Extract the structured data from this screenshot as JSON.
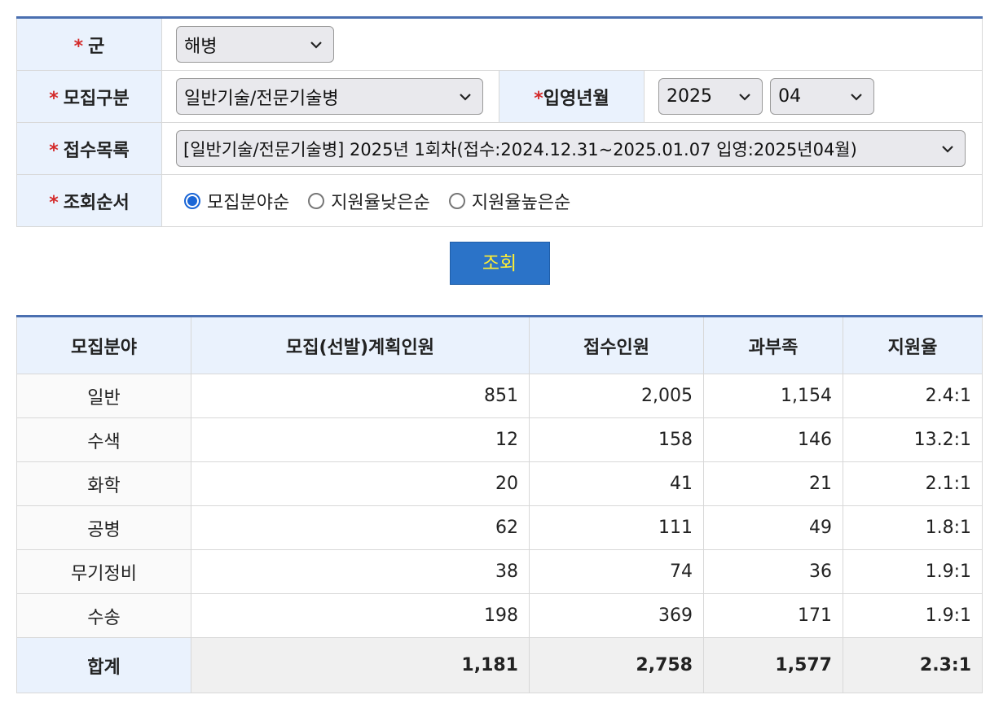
{
  "form": {
    "branch": {
      "label": "군",
      "value": "해병"
    },
    "recruit_type": {
      "label": "모집구분",
      "value": "일반기술/전문기술병"
    },
    "enlist_month": {
      "label": "입영년월",
      "year": "2025",
      "month": "04"
    },
    "application_list": {
      "label": "접수목록",
      "value": "[일반기술/전문기술병] 2025년 1회차(접수:2024.12.31~2025.01.07 입영:2025년04월)"
    },
    "sort_order": {
      "label": "조회순서",
      "options": [
        "모집분야순",
        "지원율낮은순",
        "지원율높은순"
      ],
      "selected": "모집분야순"
    },
    "required_mark": "*"
  },
  "search_button": "조회",
  "results": {
    "headers": [
      "모집분야",
      "모집(선발)계획인원",
      "접수인원",
      "과부족",
      "지원율"
    ],
    "rows": [
      {
        "field": "일반",
        "planned": "851",
        "applied": "2,005",
        "diff": "1,154",
        "ratio": "2.4:1"
      },
      {
        "field": "수색",
        "planned": "12",
        "applied": "158",
        "diff": "146",
        "ratio": "13.2:1"
      },
      {
        "field": "화학",
        "planned": "20",
        "applied": "41",
        "diff": "21",
        "ratio": "2.1:1"
      },
      {
        "field": "공병",
        "planned": "62",
        "applied": "111",
        "diff": "49",
        "ratio": "1.8:1"
      },
      {
        "field": "무기정비",
        "planned": "38",
        "applied": "74",
        "diff": "36",
        "ratio": "1.9:1"
      },
      {
        "field": "수송",
        "planned": "198",
        "applied": "369",
        "diff": "171",
        "ratio": "1.9:1"
      }
    ],
    "total": {
      "field": "합계",
      "planned": "1,181",
      "applied": "2,758",
      "diff": "1,577",
      "ratio": "2.3:1"
    }
  },
  "colors": {
    "header_bg": "#eaf2fd",
    "border_top": "#4a6fb0",
    "button_bg": "#2b73c8",
    "button_text": "#ffee33",
    "required": "#d42b2b",
    "radio_on": "#1a66d6"
  }
}
